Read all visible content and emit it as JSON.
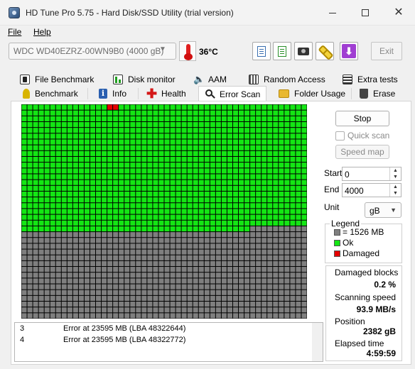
{
  "window": {
    "title": "HD Tune Pro 5.75 - Hard Disk/SSD Utility (trial version)"
  },
  "menu": {
    "file": "File",
    "help": "Help"
  },
  "toolbar": {
    "drive": "WDC WD40EZRZ-00WN9B0 (4000 gB)",
    "temperature": "36°C",
    "exit_label": "Exit"
  },
  "tabs_row1": [
    {
      "label": "File Benchmark",
      "icon": "file-benchmark-icon"
    },
    {
      "label": "Disk monitor",
      "icon": "disk-monitor-icon"
    },
    {
      "label": "AAM",
      "icon": "speaker-icon"
    },
    {
      "label": "Random Access",
      "icon": "random-access-icon"
    },
    {
      "label": "Extra tests",
      "icon": "extra-tests-icon"
    }
  ],
  "tabs_row2": [
    {
      "label": "Benchmark",
      "icon": "benchmark-icon"
    },
    {
      "label": "Info",
      "icon": "info-icon"
    },
    {
      "label": "Health",
      "icon": "health-icon"
    },
    {
      "label": "Error Scan",
      "icon": "magnifier-icon",
      "active": true
    },
    {
      "label": "Folder Usage",
      "icon": "folder-icon"
    },
    {
      "label": "Erase",
      "icon": "trash-icon"
    }
  ],
  "scan_grid": {
    "columns": 50,
    "rows": 37,
    "scanned_full_rows": 21,
    "scanned_partial_cols": 40,
    "damaged_cells": [
      [
        0,
        15
      ],
      [
        0,
        16
      ]
    ],
    "colors": {
      "ok": "#14e614",
      "unscanned": "#7f7f7f",
      "damaged": "#e60000",
      "gridline": "#000000"
    }
  },
  "errors": [
    {
      "num": "3",
      "text": "Error at 23595 MB (LBA 48322644)"
    },
    {
      "num": "4",
      "text": "Error at 23595 MB (LBA 48322772)"
    }
  ],
  "controls": {
    "stop_label": "Stop",
    "quick_scan_label": "Quick scan",
    "quick_scan_checked": false,
    "speed_map_label": "Speed map",
    "start_label": "Start",
    "start_value": "0",
    "end_label": "End",
    "end_value": "4000",
    "unit_label": "Unit",
    "unit_value": "gB"
  },
  "legend": {
    "title": "Legend",
    "block": "= 1526 MB",
    "ok": "Ok",
    "damaged": "Damaged"
  },
  "stats": {
    "damaged_blocks_label": "Damaged blocks",
    "damaged_blocks_value": "0.2 %",
    "scanning_speed_label": "Scanning speed",
    "scanning_speed_value": "93.9 MB/s",
    "position_label": "Position",
    "position_value": "2382 gB",
    "elapsed_time_label": "Elapsed time",
    "elapsed_time_value": "4:59:59"
  }
}
